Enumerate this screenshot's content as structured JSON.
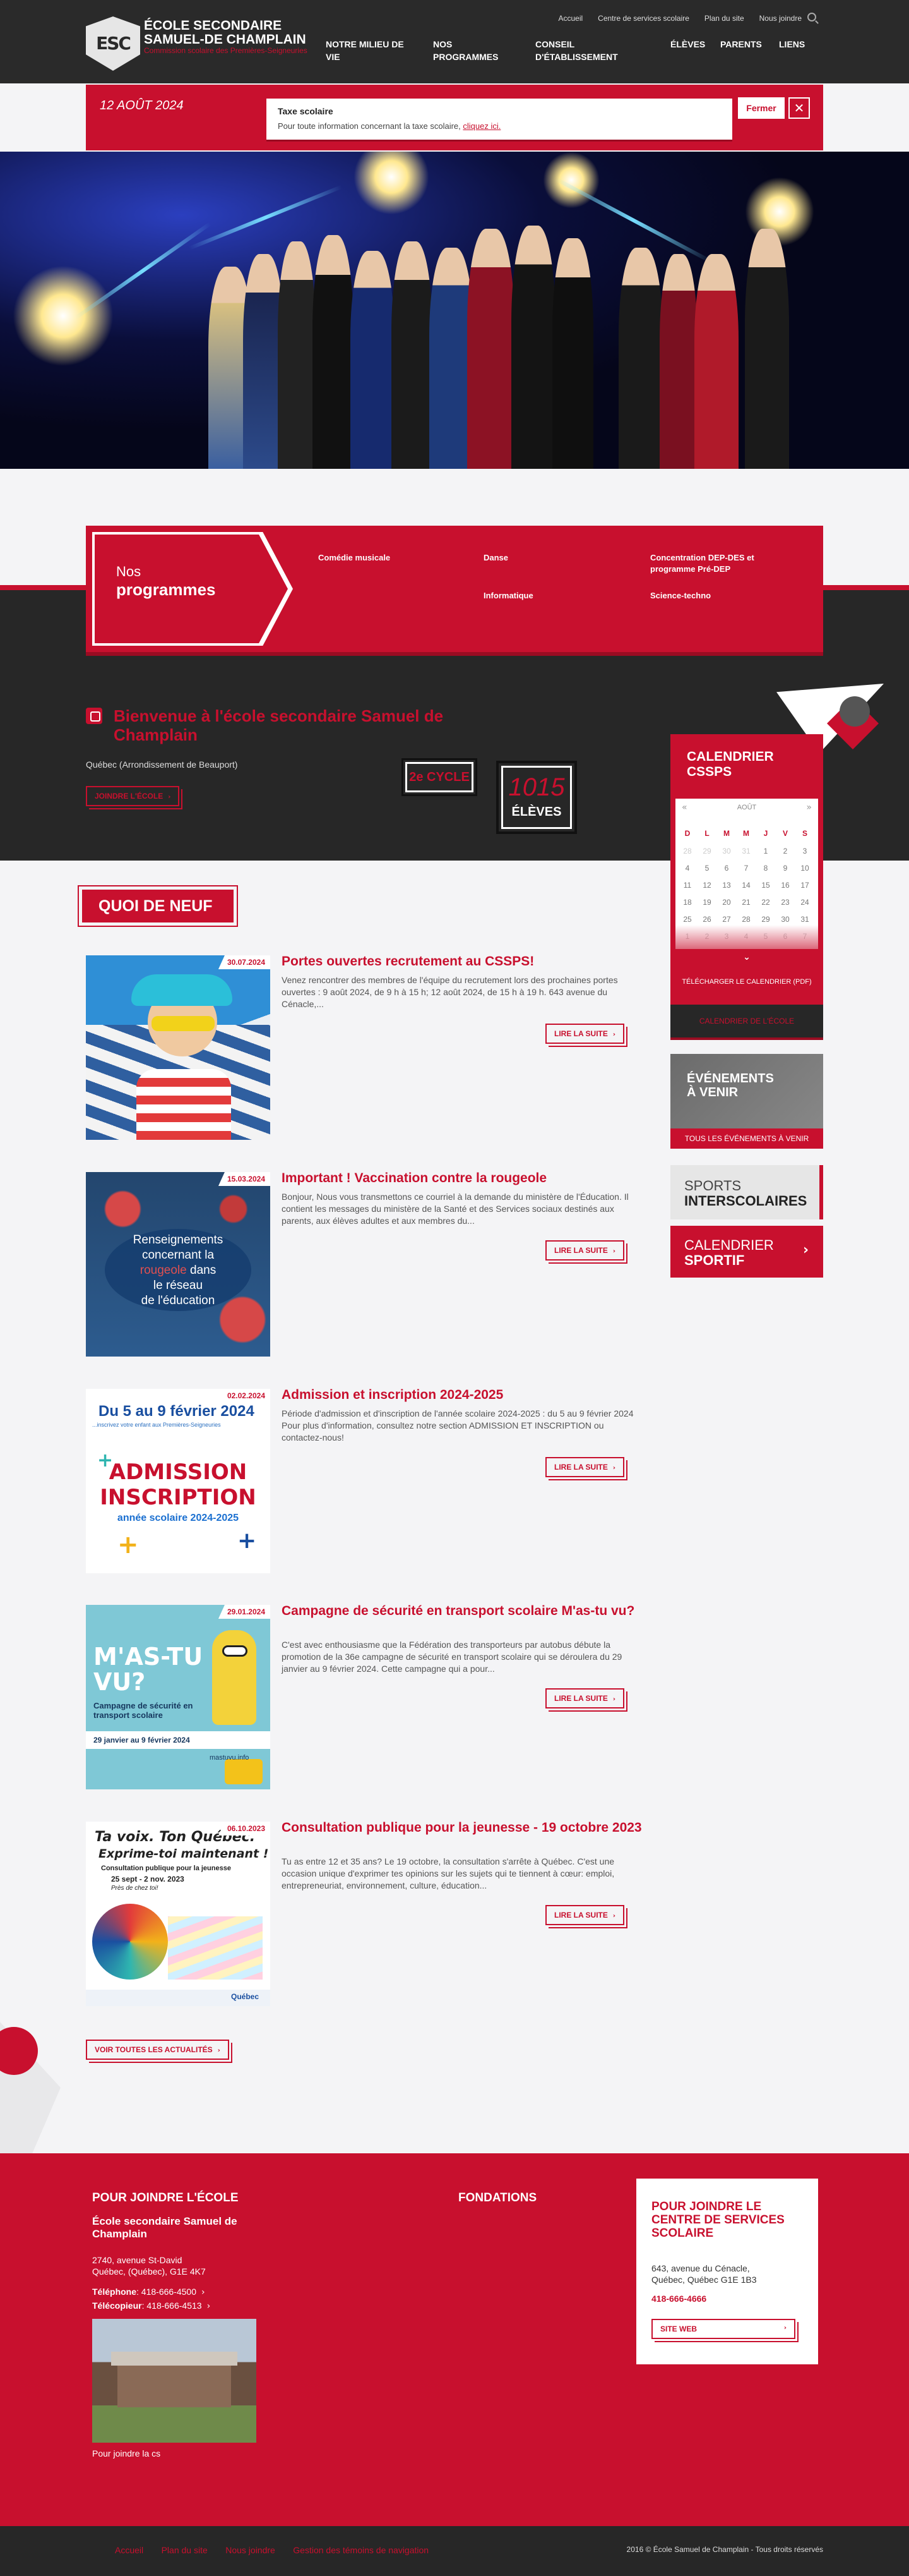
{
  "header": {
    "logo": "ESC",
    "school_name": "ÉCOLE SECONDAIRE SAMUEL-DE CHAMPLAIN",
    "school_sub": "Commission scolaire des Premières-Seigneuries",
    "util_nav": [
      "Accueil",
      "Centre de services scolaire",
      "Plan du site",
      "Nous joindre"
    ],
    "main_nav": [
      "NOTRE MILIEU DE VIE",
      "NOS PROGRAMMES",
      "CONSEIL D'ÉTABLISSEMENT",
      "ÉLÈVES",
      "PARENTS",
      "LIENS"
    ]
  },
  "alert": {
    "date": "12 AOÛT 2024",
    "title": "Taxe scolaire",
    "text": "Pour toute information concernant la taxe scolaire, ",
    "link": "cliquez ici.",
    "close_label": "Fermer",
    "close_icon": "✕"
  },
  "programmes": {
    "title1": "Nos",
    "title2": "programmes",
    "items": [
      "Comédie musicale",
      "Danse",
      "Concentration DEP-DES et programme Pré-DEP",
      "Informatique",
      "Science-techno"
    ]
  },
  "welcome": {
    "title": "Bienvenue à l'école secondaire Samuel de Champlain",
    "sub": "Québec (Arrondissement de Beauport)",
    "button": "JOINDRE L'ÉCOLE",
    "cycle": "2e CYCLE",
    "students_count": "1015",
    "students_label": "ÉLÈVES"
  },
  "calendar": {
    "title": "CALENDRIER CSSPS",
    "month": "AOÛT",
    "prev": "«",
    "next": "»",
    "days": [
      "D",
      "L",
      "M",
      "M",
      "J",
      "V",
      "S"
    ],
    "weeks": [
      [
        "28",
        "29",
        "30",
        "31",
        "1",
        "2",
        "3"
      ],
      [
        "4",
        "5",
        "6",
        "7",
        "8",
        "9",
        "10"
      ],
      [
        "11",
        "12",
        "13",
        "14",
        "15",
        "16",
        "17"
      ],
      [
        "18",
        "19",
        "20",
        "21",
        "22",
        "23",
        "24"
      ],
      [
        "25",
        "26",
        "27",
        "28",
        "29",
        "30",
        "31"
      ],
      [
        "1",
        "2",
        "3",
        "4",
        "5",
        "6",
        "7"
      ]
    ],
    "more_icon": "⌄",
    "download": "TÉLÉCHARGER LE CALENDRIER (PDF)",
    "school_cal": "CALENDRIER DE L'ÉCOLE"
  },
  "events": {
    "title": "ÉVÉNEMENTS À VENIR",
    "link": "TOUS LES ÉVÉNEMENTS À VENIR"
  },
  "sports": {
    "line1": "SPORTS",
    "line2": "INTERSCOLAIRES"
  },
  "sport_cal": {
    "line1": "CALENDRIER",
    "line2": "SPORTIF",
    "arrow": "›"
  },
  "news": {
    "heading": "QUOI DE NEUF",
    "read_more": "LIRE LA SUITE",
    "all_news": "VOIR TOUTES LES ACTUALITÉS",
    "items": [
      {
        "date": "30.07.2024",
        "title": "Portes ouvertes recrutement au CSSPS!",
        "text": "Venez rencontrer des membres de l'équipe du recrutement lors des prochaines portes ouvertes : 9 août 2024, de 9 h à 15 h; 12 août 2024, de 15 h à 19 h. 643 avenue du Cénacle,..."
      },
      {
        "date": "15.03.2024",
        "title": "Important ! Vaccination contre la rougeole",
        "text": "Bonjour, Nous vous transmettons ce courriel à la demande du ministère de l'Éducation. Il contient les messages du ministère de la Santé et des Services sociaux destinés aux parents, aux élèves adultes et aux membres du...",
        "img_text": [
          "Renseignements",
          "concernant la",
          "rougeole",
          "dans",
          "le réseau",
          "de l'éducation"
        ]
      },
      {
        "date": "02.02.2024",
        "title": "Admission et inscription 2024-2025",
        "text": "Période d'admission et d'inscription de l'année scolaire 2024-2025 : du 5 au 9 février 2024 Pour plus d'information, consultez notre section ADMISSION ET INSCRIPTION ou contactez-nous!",
        "img_text": [
          "Du 5 au 9 février 2024",
          "...inscrivez votre enfant aux Premières-Seigneuries",
          "ADMISSION",
          "INSCRIPTION",
          "année scolaire 2024-2025"
        ]
      },
      {
        "date": "29.01.2024",
        "title": "Campagne de sécurité en transport scolaire M'as-tu vu?",
        "text": "C'est avec enthousiasme que la Fédération des transporteurs par autobus débute la promotion de la 36e campagne de sécurité en transport scolaire qui se déroulera du 29 janvier au 9 février 2024. Cette campagne qui a pour...",
        "img_text": [
          "M'AS-TU",
          "VU?",
          "Campagne de sécurité en transport scolaire",
          "29 janvier au 9 février 2024",
          "mastuvu.info"
        ]
      },
      {
        "date": "06.10.2023",
        "title": "Consultation publique pour la jeunesse - 19 octobre 2023",
        "text": "Tu as entre 12 et 35 ans? Le 19 octobre, la consultation s'arrête à Québec. C'est une occasion unique d'exprimer tes opinions sur les sujets qui te tiennent à cœur: emploi, entrepreneuriat, environnement, culture, éducation...",
        "img_text": [
          "Ta voix. Ton Québec.",
          "Exprime-toi maintenant !",
          "Consultation publique pour la jeunesse",
          "25 sept - 2 nov. 2023",
          "Près de chez toi!",
          "Québec"
        ]
      }
    ]
  },
  "footer": {
    "school_heading": "POUR JOINDRE L'ÉCOLE",
    "school_name": "École secondaire Samuel de Champlain",
    "address1": "2740, avenue St-David",
    "address2": "Québec, (Québec), G1E 4K7",
    "phone_label": "Téléphone",
    "phone": ": 418-666-4500",
    "fax_label": "Télécopieur",
    "fax": ": 418-666-4513",
    "photo_caption": "Pour joindre la cs",
    "foundations": "FONDATIONS",
    "css_heading": "POUR JOINDRE LE CENTRE DE SERVICES SCOLAIRE",
    "css_address1": "643, avenue du Cénacle,",
    "css_address2": "Québec, Québec G1E 1B3",
    "css_phone": "418-666-4666",
    "css_button": "SITE WEB",
    "bottom_links": [
      "Accueil",
      "Plan du site",
      "Nous joindre",
      "Gestion des témoins de navigation"
    ],
    "copyright": "2016 © École Samuel de Champlain - Tous droits réservés"
  }
}
